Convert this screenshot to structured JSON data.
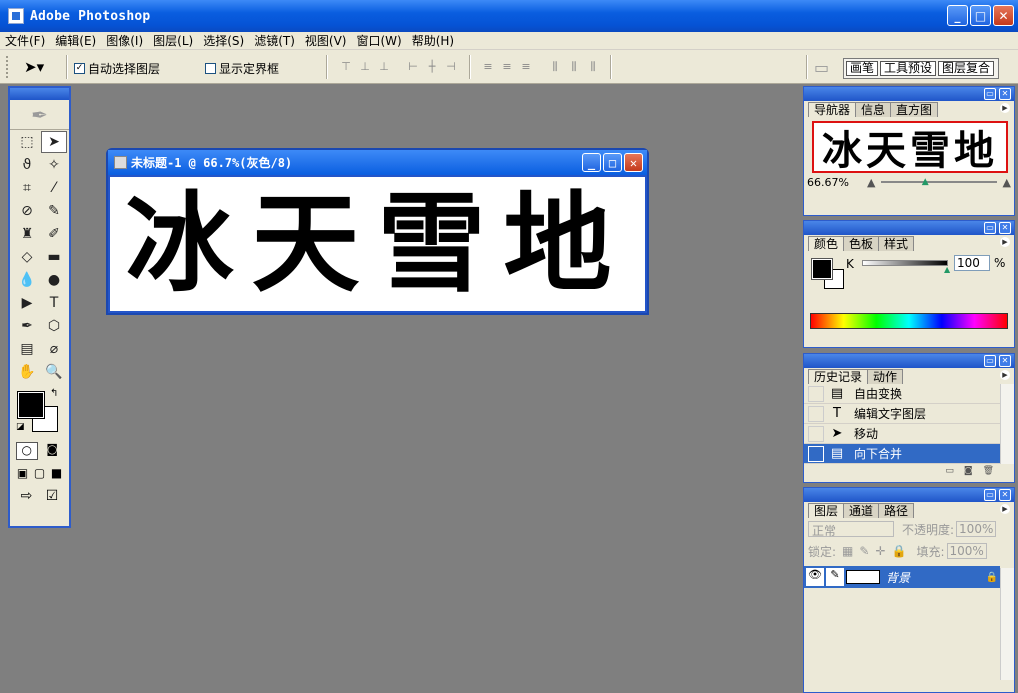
{
  "app": {
    "title": "Adobe Photoshop"
  },
  "menu": [
    "文件(F)",
    "编辑(E)",
    "图像(I)",
    "图层(L)",
    "选择(S)",
    "滤镜(T)",
    "视图(V)",
    "窗口(W)",
    "帮助(H)"
  ],
  "options": {
    "auto_select": "自动选择图层",
    "show_bounds": "显示定界框",
    "wells": [
      "画笔",
      "工具预设",
      "图层复合"
    ]
  },
  "document": {
    "title": "未标题-1 @ 66.7%(灰色/8)",
    "text": "冰天雪地"
  },
  "navigator": {
    "tabs": [
      "导航器",
      "信息",
      "直方图"
    ],
    "thumb_text": "冰天雪地",
    "zoom": "66.67%"
  },
  "color": {
    "tabs": [
      "颜色",
      "色板",
      "样式"
    ],
    "channel": "K",
    "value": "100",
    "unit": "%"
  },
  "history": {
    "tabs": [
      "历史记录",
      "动作"
    ],
    "items": [
      "自由变换",
      "编辑文字图层",
      "移动",
      "向下合并"
    ]
  },
  "layers": {
    "tabs": [
      "图层",
      "通道",
      "路径"
    ],
    "blend": "正常",
    "opacity_label": "不透明度:",
    "opacity": "100%",
    "lock_label": "锁定:",
    "fill_label": "填充:",
    "fill": "100%",
    "layer_name": "背景"
  },
  "colors": {
    "accent": "#316ac5",
    "titlebar": "#0a5ee0",
    "canvas_bg": "#7f7f7f"
  }
}
